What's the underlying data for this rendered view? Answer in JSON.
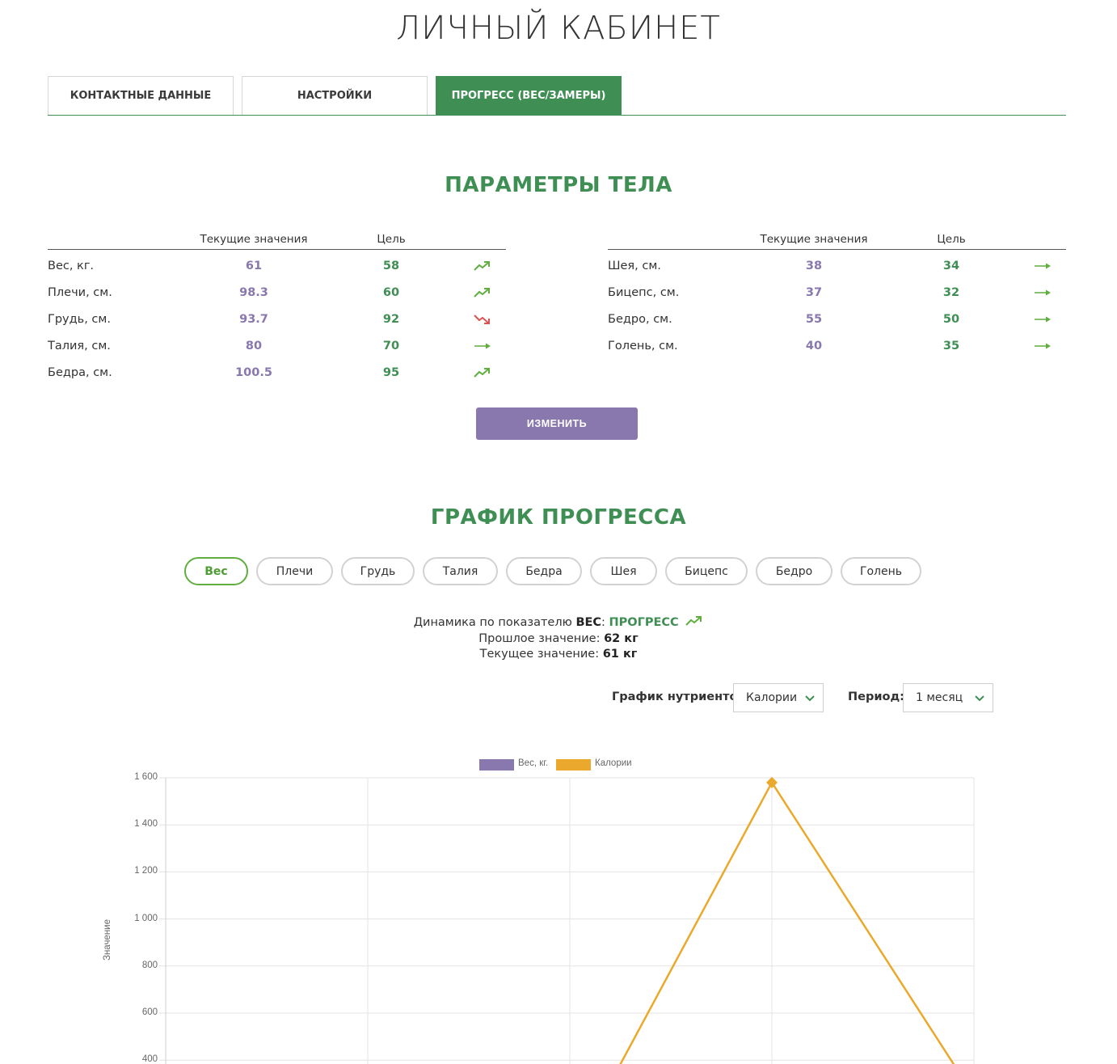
{
  "page_title": "ЛИЧНЫЙ КАБИНЕТ",
  "tabs": [
    {
      "label": "КОНТАКТНЫЕ ДАННЫЕ",
      "active": false
    },
    {
      "label": "НАСТРОЙКИ",
      "active": false
    },
    {
      "label": "ПРОГРЕСС (ВЕС/ЗАМЕРЫ)",
      "active": true
    }
  ],
  "body_params": {
    "title": "ПАРАМЕТРЫ ТЕЛА",
    "col_current": "Текущие значения",
    "col_goal": "Цель",
    "left": [
      {
        "label": "Вес, кг.",
        "current": "61",
        "goal": "58",
        "trend": "up"
      },
      {
        "label": "Плечи, см.",
        "current": "98.3",
        "goal": "60",
        "trend": "up"
      },
      {
        "label": "Грудь, см.",
        "current": "93.7",
        "goal": "92",
        "trend": "down"
      },
      {
        "label": "Талия, см.",
        "current": "80",
        "goal": "70",
        "trend": "flat"
      },
      {
        "label": "Бедра, см.",
        "current": "100.5",
        "goal": "95",
        "trend": "up"
      }
    ],
    "right": [
      {
        "label": "Шея, см.",
        "current": "38",
        "goal": "34",
        "trend": "flat"
      },
      {
        "label": "Бицепс, см.",
        "current": "37",
        "goal": "32",
        "trend": "flat"
      },
      {
        "label": "Бедро, см.",
        "current": "55",
        "goal": "50",
        "trend": "flat"
      },
      {
        "label": "Голень, см.",
        "current": "40",
        "goal": "35",
        "trend": "flat"
      }
    ],
    "edit_label": "ИЗМЕНИТЬ",
    "colors": {
      "up": "#5fae3f",
      "down": "#d9534f",
      "flat": "#5fae3f"
    }
  },
  "progress": {
    "title": "ГРАФИК ПРОГРЕССА",
    "metrics": [
      "Вес",
      "Плечи",
      "Грудь",
      "Талия",
      "Бедра",
      "Шея",
      "Бицепс",
      "Бедро",
      "Голень"
    ],
    "active_metric": "Вес",
    "dynamics_prefix": "Динамика по показателю",
    "dynamics_metric": "ВЕС",
    "dynamics_status": "ПРОГРЕСС",
    "previous_label": "Прошлое значение:",
    "previous_value": "62 кг",
    "current_label": "Текущее значение:",
    "current_value": "61 кг",
    "nutrients_label": "График нутриентов:",
    "nutrients_value": "Калории",
    "period_label": "Период:",
    "period_value": "1 месяц"
  },
  "chart_data": {
    "type": "line",
    "ylabel": "Значение",
    "yticks": [
      "1 600",
      "1 400",
      "1 200",
      "1 000",
      "800",
      "600",
      "400"
    ],
    "ylim": [
      0,
      1600
    ],
    "grid": true,
    "legend_position": "top-center",
    "series": [
      {
        "name": "Вес, кг.",
        "color": "#8878ad",
        "values": [
          null,
          null,
          null,
          null,
          null
        ]
      },
      {
        "name": "Калории",
        "color": "#eaa92c",
        "values": [
          null,
          null,
          null,
          1580,
          null
        ]
      }
    ]
  }
}
